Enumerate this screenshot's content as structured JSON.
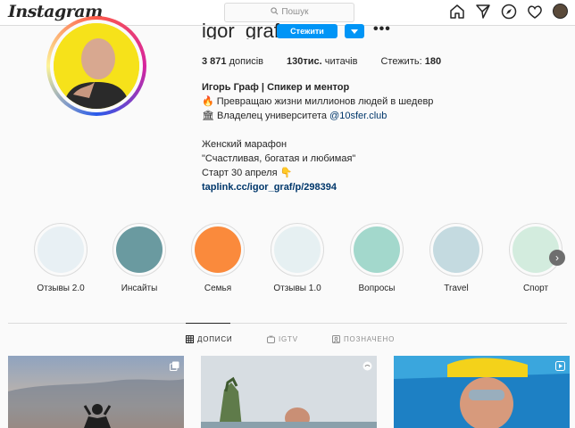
{
  "nav": {
    "logo": "Instagram",
    "search_placeholder": "Пошук",
    "icons": [
      "home-icon",
      "direct-icon",
      "explore-icon",
      "activity-heart-icon",
      "profile-avatar"
    ]
  },
  "profile": {
    "username": "igor_graf",
    "follow_label": "Стежити",
    "stats": {
      "posts_value": "3 871",
      "posts_label": "дописів",
      "followers_value": "130тис.",
      "followers_label": "читачів",
      "following_label": "Стежить:",
      "following_value": "180"
    },
    "bio": {
      "name": "Игорь Граф | Спикер и ментор",
      "line1": "🔥 Превращаю жизни миллионов людей в шедевр",
      "line2_prefix": "🏛 Владелец университета ",
      "line2_mention": "@10sfer.club",
      "line3": "Женский марафон",
      "line4": "\"Счастливая, богатая и любимая\"",
      "line5": "Старт 30 апреля 👇",
      "link": "taplink.cc/igor_graf/p/298394"
    }
  },
  "highlights": [
    {
      "label": "Отзывы 2.0",
      "color": "#e8f0f4"
    },
    {
      "label": "Инсайты",
      "color": "#6a9aa0"
    },
    {
      "label": "Семья",
      "color": "#fa8a3c"
    },
    {
      "label": "Отзывы 1.0",
      "color": "#e6f0f2"
    },
    {
      "label": "Вопросы",
      "color": "#a3d8cc"
    },
    {
      "label": "Travel",
      "color": "#c4dae0"
    },
    {
      "label": "Спорт",
      "color": "#d3ecde"
    }
  ],
  "tabs": [
    {
      "label": "ДОПИСИ",
      "active": true
    },
    {
      "label": "IGTV",
      "active": false
    },
    {
      "label": "ПОЗНАЧЕНО",
      "active": false
    }
  ],
  "colors": {
    "accent": "#0095f6",
    "link": "#00376b",
    "border": "#dbdbdb"
  }
}
